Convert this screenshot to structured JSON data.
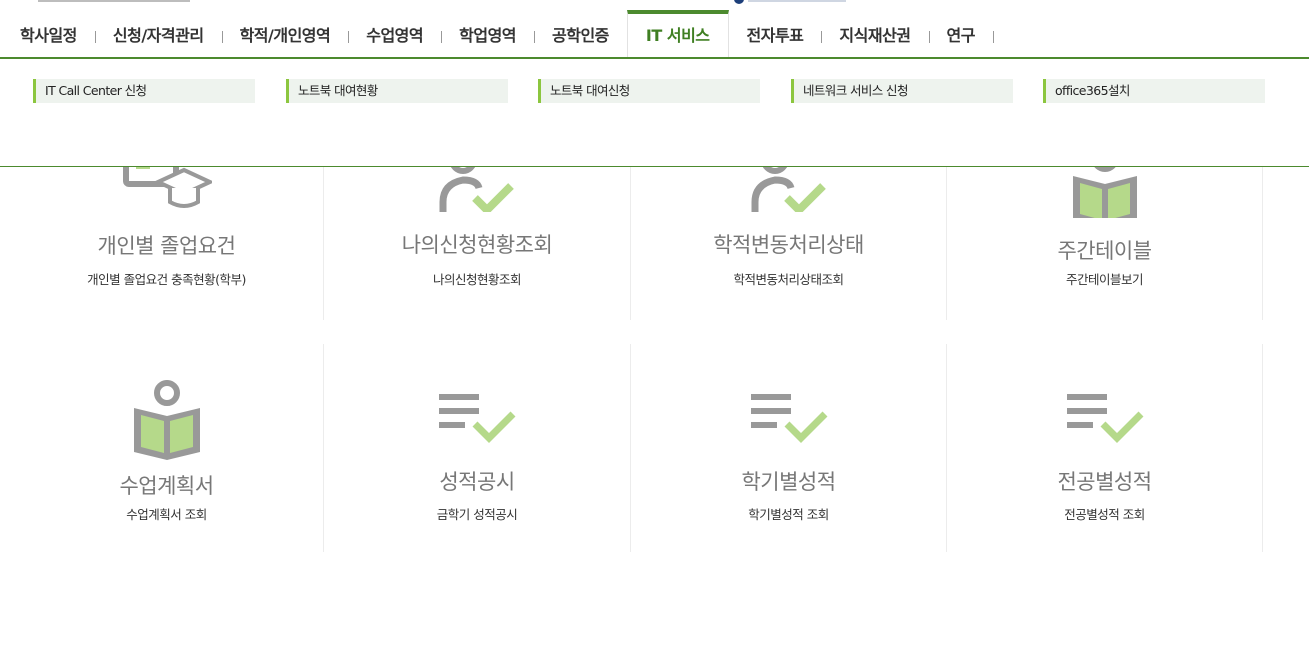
{
  "nav": {
    "items": [
      {
        "label": "학사일정"
      },
      {
        "label": "신청/자격관리"
      },
      {
        "label": "학적/개인영역"
      },
      {
        "label": "수업영역"
      },
      {
        "label": "학업영역"
      },
      {
        "label": "공학인증"
      },
      {
        "label": "IT 서비스",
        "active": true
      },
      {
        "label": "전자투표"
      },
      {
        "label": "지식재산권"
      },
      {
        "label": "연구"
      }
    ]
  },
  "submenu": {
    "items": [
      {
        "label": "IT Call Center 신청"
      },
      {
        "label": "노트북 대여현황"
      },
      {
        "label": "노트북 대여신청"
      },
      {
        "label": "네트워크 서비스 신청"
      },
      {
        "label": "office365설치"
      }
    ]
  },
  "cards": {
    "row1": [
      {
        "title": "개인별 졸업요건",
        "desc": "개인별 졸업요건 충족현황(학부)",
        "icon": "graduation-cap-icon"
      },
      {
        "title": "나의신청현황조회",
        "desc": "나의신청현황조회",
        "icon": "person-check-icon"
      },
      {
        "title": "학적변동처리상태",
        "desc": "학적변동처리상태조회",
        "icon": "person-check-icon"
      },
      {
        "title": "주간테이블",
        "desc": "주간테이블보기",
        "icon": "reader-book-icon"
      }
    ],
    "row2": [
      {
        "title": "수업계획서",
        "desc": "수업계획서 조회",
        "icon": "reader-book-icon"
      },
      {
        "title": "성적공시",
        "desc": "금학기 성적공시",
        "icon": "list-check-icon"
      },
      {
        "title": "학기별성적",
        "desc": "학기별성적 조회",
        "icon": "list-check-icon"
      },
      {
        "title": "전공별성적",
        "desc": "전공별성적 조회",
        "icon": "list-check-icon"
      }
    ]
  },
  "colors": {
    "accent": "#4c8a2e",
    "icon_green": "#b5d98a",
    "icon_gray": "#999999"
  }
}
